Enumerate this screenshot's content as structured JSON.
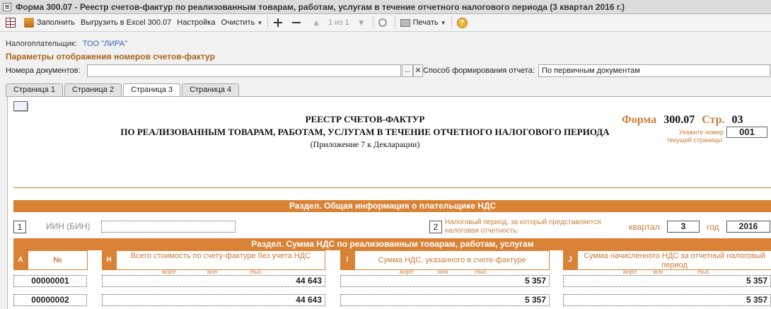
{
  "window": {
    "title": "Форма 300.07 - Реестр счетов-фактур по реализованным товарам, работам, услугам в течение отчетного налогового периода (3 квартал 2016 г.)"
  },
  "toolbar": {
    "fill": "Заполнить",
    "export": "Выгрузить в Excel 300.07",
    "settings": "Настройка",
    "clear": "Очистить",
    "pager": "1 из 1",
    "print": "Печать"
  },
  "taxpayer": {
    "label": "Налогоплательщик:",
    "value": "ТОО \"ЛИРА\""
  },
  "params": {
    "title": "Параметры отображения номеров счетов-фактур",
    "docs_label": "Номера документов:",
    "docs_value": "",
    "docs_browse": "...",
    "docs_clear": "✕",
    "method_label": "Способ формирования отчета:",
    "method_value": "По первичным документам"
  },
  "tabs": [
    {
      "label": "Страница 1"
    },
    {
      "label": "Страница 2"
    },
    {
      "label": "Страница 3"
    },
    {
      "label": "Страница 4"
    }
  ],
  "sheet": {
    "title_line1": "РЕЕСТР СЧЕТОВ-ФАКТУР",
    "title_line2": "ПО РЕАЛИЗОВАННЫМ ТОВАРАМ, РАБОТАМ, УСЛУГАМ В ТЕЧЕНИЕ ОТЧЕТНОГО НАЛОГОВОГО ПЕРИОДА",
    "title_line3": "(Приложение 7 к Декларации)",
    "form_label": "Форма",
    "form_number": "300.07",
    "page_label": "Стр.",
    "page_number": "03",
    "page_hint": "Укажите номер текущей страницы:",
    "page_input": "001",
    "section1": "Раздел. Общая информация о плательщике НДС",
    "box1": "1",
    "iin_label": "ИИН (БИН)",
    "iin_value": "",
    "box2": "2",
    "period_label": "Налоговый период, за который представляется налоговая отчетность:",
    "quarter_label": "квартал",
    "quarter_value": "3",
    "year_label": "год",
    "year_value": "2016",
    "section2": "Раздел. Сумма НДС по реализованным товарам, работам, услугам",
    "columns": [
      {
        "letter": "A",
        "caption": "№"
      },
      {
        "letter": "H",
        "caption": "Всего стоимость по счету-фактуре без учета НДС"
      },
      {
        "letter": "I",
        "caption": "Сумма НДС, указанного в счете-фактуре"
      },
      {
        "letter": "J",
        "caption": "Сумма начисленного НДС за отчетный налоговый период"
      }
    ],
    "units": {
      "bln": "млрд",
      "mln": "млн",
      "ths": "тыс."
    },
    "rows": [
      {
        "no": "00000001",
        "total": "44 643",
        "vat": "5 357",
        "accrued": "5 357"
      },
      {
        "no": "00000002",
        "total": "44 643",
        "vat": "5 357",
        "accrued": "5 357"
      }
    ]
  }
}
